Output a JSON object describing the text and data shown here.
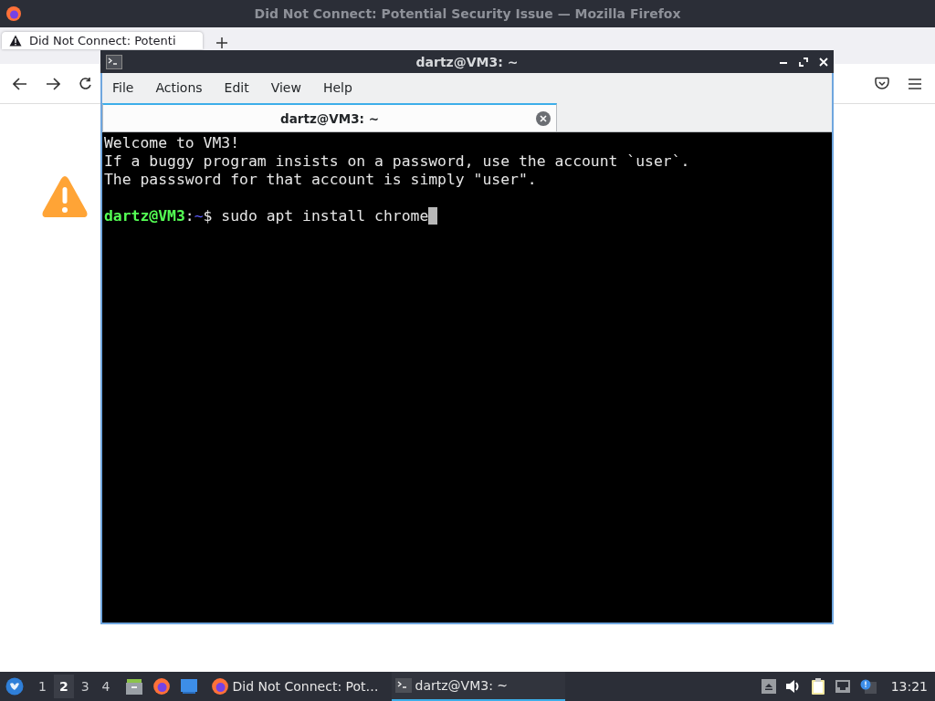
{
  "browser": {
    "title": "Did Not Connect: Potential Security Issue — Mozilla Firefox",
    "tab": {
      "label": "Did Not Connect: Potenti",
      "selected": true
    }
  },
  "terminal": {
    "title": "dartz@VM3: ~",
    "menu": [
      "File",
      "Actions",
      "Edit",
      "View",
      "Help"
    ],
    "tab": {
      "label": "dartz@VM3: ~",
      "selected": true
    },
    "lines": [
      {
        "kind": "text",
        "text": "Welcome to VM3!"
      },
      {
        "kind": "text",
        "text": "If a buggy program insists on a password, use the account `user`."
      },
      {
        "kind": "text",
        "text": "The passsword for that account is simply \"user\"."
      },
      {
        "kind": "blank"
      },
      {
        "kind": "prompt",
        "user_host": "dartz@VM3",
        "separator": ":",
        "path": "~",
        "command": "$ sudo apt install chrome",
        "cursor": true
      }
    ]
  },
  "taskbar": {
    "workspaces": [
      {
        "label": "1",
        "selected": false
      },
      {
        "label": "2",
        "selected": true
      },
      {
        "label": "3",
        "selected": false
      },
      {
        "label": "4",
        "selected": false
      }
    ],
    "tasks": [
      {
        "kind": "browser",
        "label": "Did Not Connect: Pot…",
        "selected": false
      },
      {
        "kind": "terminal",
        "label": "dartz@VM3: ~",
        "selected": true
      }
    ],
    "clock": "13:21"
  }
}
